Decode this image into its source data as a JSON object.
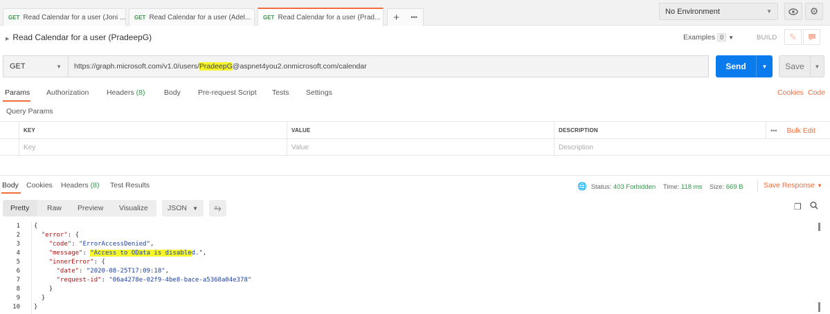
{
  "tabs": [
    {
      "method": "GET",
      "title": "Read Calendar for a user (Joni ...",
      "active": false
    },
    {
      "method": "GET",
      "title": "Read Calendar for a user (Adel...",
      "active": false
    },
    {
      "method": "GET",
      "title": "Read Calendar for a user (Prad...",
      "active": true,
      "close": "✕"
    }
  ],
  "tab_actions": {
    "add": "+",
    "more": "•••"
  },
  "environment": {
    "selected": "No Environment"
  },
  "request": {
    "title": "Read Calendar for a user (PradeepG)",
    "examples_label": "Examples",
    "examples_count": "0",
    "build_label": "BUILD",
    "method": "GET",
    "url_prefix": "https://graph.microsoft.com/v1.0/users/",
    "url_highlight": "PradeepG",
    "url_suffix": "@aspnet4you2.onmicrosoft.com/calendar",
    "send_label": "Send",
    "save_label": "Save"
  },
  "request_tabs": {
    "params": "Params",
    "authorization": "Authorization",
    "headers": "Headers",
    "headers_count": "(8)",
    "body": "Body",
    "prerequest": "Pre-request Script",
    "tests": "Tests",
    "settings": "Settings",
    "cookies": "Cookies",
    "code": "Code"
  },
  "query_params": {
    "label": "Query Params",
    "columns": {
      "key": "KEY",
      "value": "VALUE",
      "description": "DESCRIPTION"
    },
    "placeholders": {
      "key": "Key",
      "value": "Value",
      "description": "Description"
    },
    "more": "•••",
    "bulk_edit": "Bulk Edit"
  },
  "response_tabs": {
    "body": "Body",
    "cookies": "Cookies",
    "headers": "Headers",
    "headers_count": "(8)",
    "test_results": "Test Results"
  },
  "response_status": {
    "status_label": "Status:",
    "status_value": "403 Forbidden",
    "time_label": "Time:",
    "time_value": "118 ms",
    "size_label": "Size:",
    "size_value": "669 B",
    "save_response": "Save Response"
  },
  "view_options": {
    "pretty": "Pretty",
    "raw": "Raw",
    "preview": "Preview",
    "visualize": "Visualize",
    "format": "JSON"
  },
  "response_body": {
    "line_numbers": [
      "1",
      "2",
      "3",
      "4",
      "5",
      "6",
      "7",
      "8",
      "9",
      "10"
    ],
    "open_brace": "{",
    "error_key": "\"error\"",
    "code_key": "\"code\"",
    "code_value": "\"ErrorAccessDenied\"",
    "message_key": "\"message\"",
    "message_highlight": "\"Access to OData is disable",
    "message_rest": "d.\"",
    "inner_key": "\"innerError\"",
    "date_key": "\"date\"",
    "date_value": "\"2020-08-25T17:09:18\"",
    "reqid_key": "\"request-id\"",
    "reqid_value": "\"06a4278e-02f9-4be8-bace-a5368a04e378\"",
    "close_inner": "}",
    "close_error": "}",
    "close_root": "}"
  },
  "colors": {
    "accent": "#f26b3a",
    "send": "#097bed",
    "status_ok": "#2e9a47"
  }
}
